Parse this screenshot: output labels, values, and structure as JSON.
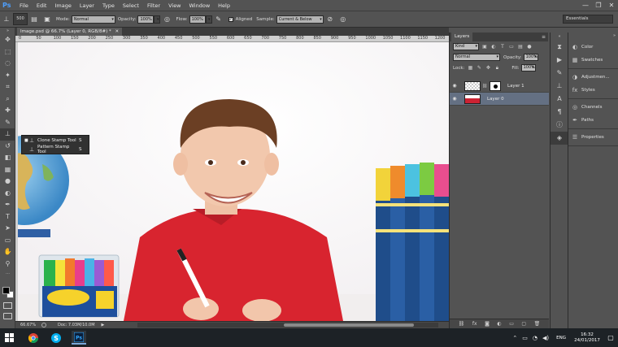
{
  "app": {
    "logo": "Ps"
  },
  "menubar": {
    "items": [
      "File",
      "Edit",
      "Image",
      "Layer",
      "Type",
      "Select",
      "Filter",
      "View",
      "Window",
      "Help"
    ],
    "controls": {
      "minimize": "—",
      "restore": "❐",
      "close": "✕"
    }
  },
  "options": {
    "brush_size": "500",
    "mode_label": "Mode:",
    "mode_value": "Normal",
    "opacity_label": "Opacity:",
    "opacity_value": "100%",
    "flow_label": "Flow:",
    "flow_value": "100%",
    "aligned_label": "Aligned",
    "sample_label": "Sample:",
    "sample_value": "Current & Below",
    "workspace": "Essentials"
  },
  "document": {
    "tab_title": "Image.psd @ 66.7% (Layer 0, RGB/8#) *",
    "ruler_ticks": [
      "0",
      "50",
      "100",
      "150",
      "200",
      "250",
      "300",
      "350",
      "400",
      "450",
      "500",
      "550",
      "600",
      "650",
      "700",
      "750",
      "800",
      "850",
      "900",
      "950",
      "1000",
      "1050",
      "1100",
      "1150",
      "1200"
    ]
  },
  "flyout": {
    "items": [
      {
        "label": "Clone Stamp Tool",
        "key": "S",
        "icon": "stamp-icon",
        "active": true
      },
      {
        "label": "Pattern Stamp Tool",
        "key": "S",
        "icon": "pattern-stamp-icon",
        "active": false
      }
    ]
  },
  "status": {
    "zoom": "66.67%",
    "doc_size": "Doc: 7.03M/10.0M"
  },
  "layers_panel": {
    "tab": "Layers",
    "kind_label": "Kind",
    "blend_mode": "Normal",
    "opacity_label": "Opacity:",
    "opacity_value": "100%",
    "lock_label": "Lock:",
    "fill_label": "Fill:",
    "fill_value": "100%",
    "layers": [
      {
        "name": "Layer 1",
        "selected": false,
        "has_mask": true
      },
      {
        "name": "Layer 0",
        "selected": true,
        "has_mask": false
      }
    ]
  },
  "mini_panels": {
    "groups": [
      [
        "Color",
        "Swatches"
      ],
      [
        "Adjustmen...",
        "Styles"
      ],
      [
        "Channels",
        "Paths"
      ],
      [
        "Properties"
      ]
    ]
  },
  "taskbar": {
    "language": "ENG",
    "time": "16:32",
    "date": "24/01/2017"
  }
}
